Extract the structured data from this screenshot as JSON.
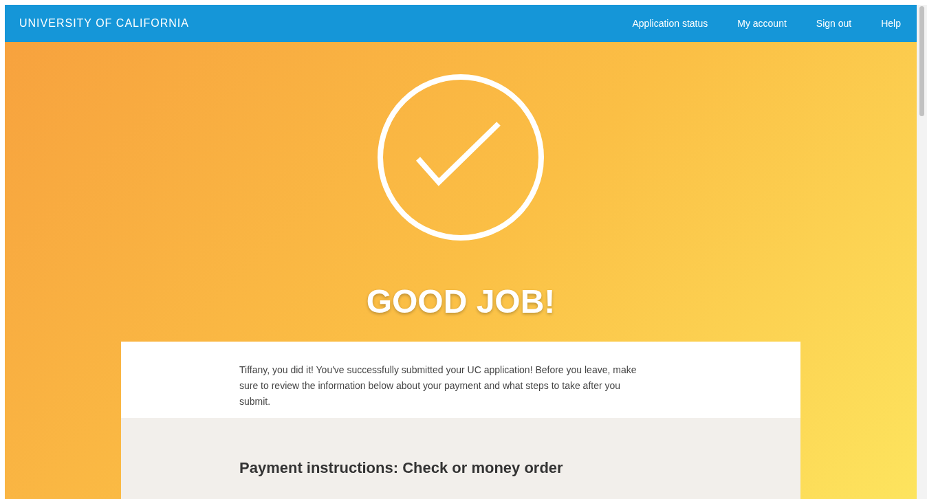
{
  "header": {
    "brand": "UNIVERSITY OF CALIFORNIA",
    "nav": [
      "Application status",
      "My account",
      "Sign out",
      "Help"
    ]
  },
  "hero": {
    "title": "GOOD JOB!"
  },
  "card": {
    "intro": "Tiffany, you did it! You've successfully submitted your UC application! Before you leave, make sure to review the information below about your payment and what steps to take after you submit.",
    "section_heading": "Payment instructions: Check or money order"
  }
}
